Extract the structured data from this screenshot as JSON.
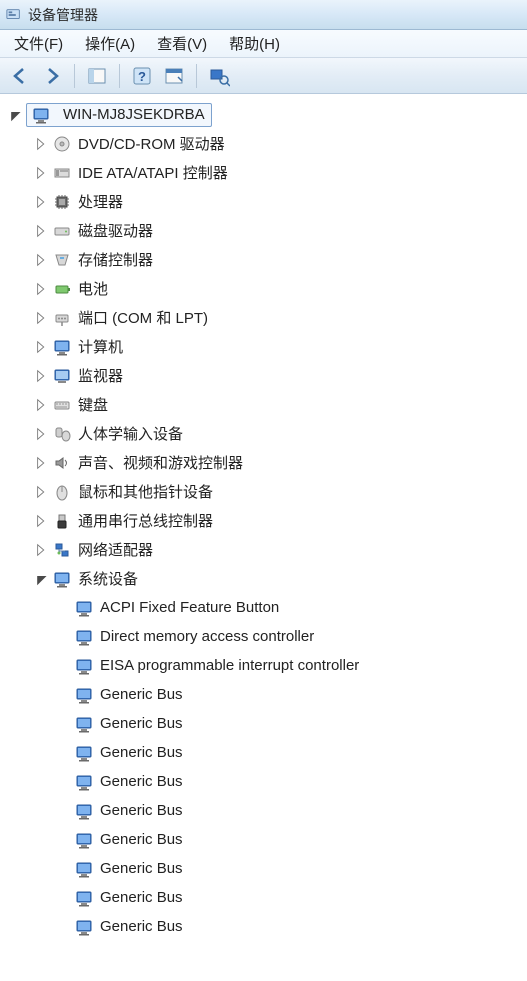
{
  "window": {
    "title": "设备管理器"
  },
  "menu": {
    "file": "文件(F)",
    "action": "操作(A)",
    "view": "查看(V)",
    "help": "帮助(H)"
  },
  "tree": {
    "root": "WIN-MJ8JSEKDRBA",
    "categories": [
      {
        "label": "DVD/CD-ROM 驱动器",
        "icon": "disc"
      },
      {
        "label": "IDE ATA/ATAPI 控制器",
        "icon": "ide"
      },
      {
        "label": "处理器",
        "icon": "cpu"
      },
      {
        "label": "磁盘驱动器",
        "icon": "hdd"
      },
      {
        "label": "存储控制器",
        "icon": "storage"
      },
      {
        "label": "电池",
        "icon": "battery"
      },
      {
        "label": "端口 (COM 和 LPT)",
        "icon": "port"
      },
      {
        "label": "计算机",
        "icon": "computer"
      },
      {
        "label": "监视器",
        "icon": "monitor"
      },
      {
        "label": "键盘",
        "icon": "keyboard"
      },
      {
        "label": "人体学输入设备",
        "icon": "hid"
      },
      {
        "label": "声音、视频和游戏控制器",
        "icon": "sound"
      },
      {
        "label": "鼠标和其他指针设备",
        "icon": "mouse"
      },
      {
        "label": "通用串行总线控制器",
        "icon": "usb"
      },
      {
        "label": "网络适配器",
        "icon": "network"
      }
    ],
    "expanded_category": {
      "label": "系统设备",
      "icon": "computer",
      "children": [
        "ACPI Fixed Feature Button",
        "Direct memory access controller",
        "EISA programmable interrupt controller",
        "Generic Bus",
        "Generic Bus",
        "Generic Bus",
        "Generic Bus",
        "Generic Bus",
        "Generic Bus",
        "Generic Bus",
        "Generic Bus",
        "Generic Bus"
      ]
    }
  }
}
